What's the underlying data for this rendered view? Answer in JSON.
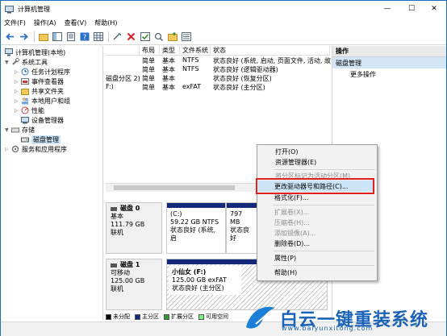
{
  "window": {
    "title": "计算机管理",
    "minimize": "—",
    "maximize": "☐",
    "close": "✕"
  },
  "menu": [
    "文件(F)",
    "操作(A)",
    "查看(V)",
    "帮助(H)"
  ],
  "tree": {
    "root": "计算机管理(本地)",
    "system_tools": "系统工具",
    "task_scheduler": "任务计划程序",
    "event_viewer": "事件查看器",
    "shared_folders": "共享文件夹",
    "local_users": "本地用户和组",
    "performance": "性能",
    "device_manager": "设备管理器",
    "storage": "存储",
    "disk_management": "磁盘管理",
    "services_apps": "服务和应用程序"
  },
  "volume_table": {
    "headers": [
      "布局",
      "类型",
      "文件系统",
      "状态"
    ],
    "rows": [
      {
        "name": "",
        "layout": "简单",
        "type": "基本",
        "fs": "NTFS",
        "status": "状态良好 (系统, 启动, 页面文件, 活动, 故"
      },
      {
        "name": "",
        "layout": "简单",
        "type": "基本",
        "fs": "NTFS",
        "status": "状态良好 (逻辑驱动器)"
      },
      {
        "name": "磁盘分区 2)",
        "layout": "简单",
        "type": "基本",
        "fs": "",
        "status": "状态良好 (恢复分区)"
      },
      {
        "name": "F:)",
        "layout": "简单",
        "type": "基本",
        "fs": "exFAT",
        "status": "状态良好 (主分区)"
      }
    ]
  },
  "disks": [
    {
      "name": "磁盘 0",
      "kind": "基本",
      "size": "111.79 GB",
      "state": "联机",
      "partitions": [
        {
          "title": "(C:)",
          "detail": "59.22 GB NTFS",
          "status": "状态良好 (系统, 启"
        },
        {
          "title": "",
          "detail": "797 MB",
          "status": "状态良好"
        }
      ]
    },
    {
      "name": "磁盘 1",
      "kind": "可移动",
      "size": "125.00 GB",
      "state": "联机",
      "partitions": [
        {
          "title": "小仙女  (F:)",
          "detail": "125.00 GB exFAT",
          "status": "状态良好 (主分区)"
        }
      ]
    }
  ],
  "legend": [
    {
      "label": "未分配",
      "color": "#000000"
    },
    {
      "label": "主分区",
      "color": "#14287c"
    },
    {
      "label": "扩展分区",
      "color": "#2e9b2e"
    },
    {
      "label": "可用空间",
      "color": "#7cf27c"
    }
  ],
  "actions": {
    "header": "操作",
    "section": "磁盘管理",
    "more": "更多操作"
  },
  "context_menu": {
    "open": "打开(O)",
    "explore": "资源管理器(E)",
    "mark_active": "将分区标记为活动分区(M)",
    "change_letter": "更改驱动器号和路径(C)...",
    "format": "格式化(F)...",
    "extend": "扩展卷(X)...",
    "shrink": "压缩卷(H)...",
    "add_mirror": "添加镜像(A)...",
    "delete": "删除卷(D)...",
    "properties": "属性(P)",
    "help": "帮助(H)"
  },
  "watermark": {
    "brand": "白云一键重装系统",
    "url": "www.baiyunxitong.com"
  },
  "colors": {
    "primary_partition": "#14287c",
    "highlight_border": "#e12020",
    "selection": "#cce4f7",
    "brand_blue": "#1a63b8"
  }
}
